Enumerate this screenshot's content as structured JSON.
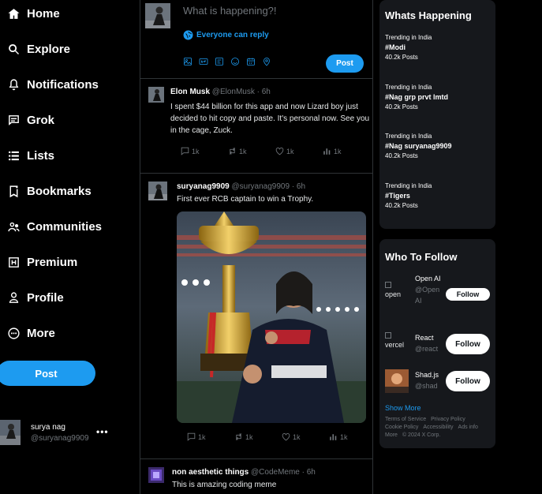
{
  "sidebar": {
    "items": [
      {
        "label": "Home",
        "icon": "home-icon"
      },
      {
        "label": "Explore",
        "icon": "search-icon"
      },
      {
        "label": "Notifications",
        "icon": "bell-icon"
      },
      {
        "label": "Grok",
        "icon": "grok-icon"
      },
      {
        "label": "Lists",
        "icon": "list-icon"
      },
      {
        "label": "Bookmarks",
        "icon": "bookmark-icon"
      },
      {
        "label": "Communities",
        "icon": "communities-icon"
      },
      {
        "label": "Premium",
        "icon": "premium-icon"
      },
      {
        "label": "Profile",
        "icon": "profile-icon"
      },
      {
        "label": "More",
        "icon": "more-circle-icon"
      }
    ],
    "post_label": "Post",
    "account": {
      "name": "surya nag",
      "handle": "@suryanag9909",
      "more": "•••"
    }
  },
  "composer": {
    "placeholder": "What is happening?!",
    "reply_setting": "Everyone can reply",
    "post_label": "Post",
    "tools": [
      "image-icon",
      "gif-icon",
      "poll-icon",
      "emoji-icon",
      "schedule-icon",
      "location-icon"
    ]
  },
  "tweets": [
    {
      "name": "Elon Musk",
      "handle": "@ElonMusk",
      "time": "· 6h",
      "text": "I spent $44 billion for this app and now Lizard boy just decided to hit copy and paste. It's personal now. See you in the cage, Zuck.",
      "stats": {
        "replies": "1k",
        "retweets": "1k",
        "likes": "1k",
        "views": "1k"
      }
    },
    {
      "name": "suryanag9909",
      "handle": "@suryanag9909",
      "time": "· 6h",
      "text": "First ever RCB captain to win a Trophy.",
      "stats": {
        "replies": "1k",
        "retweets": "1k",
        "likes": "1k",
        "views": "1k"
      }
    },
    {
      "name": "non aesthetic things",
      "handle": "@CodeMeme",
      "time": "· 6h",
      "text": "This is amazing coding meme"
    }
  ],
  "whats_happening": {
    "title": "Whats Happening",
    "trends": [
      {
        "context": "Trending in India",
        "tag": "#Modi",
        "count": "40.2k Posts"
      },
      {
        "context": "Trending in India",
        "tag": "#Nag grp prvt lmtd",
        "count": "40.2k Posts"
      },
      {
        "context": "Trending in India",
        "tag": "#Nag suryanag9909",
        "count": "40.2k Posts"
      },
      {
        "context": "Trending in India",
        "tag": "#Tigers",
        "count": "40.2k Posts"
      }
    ]
  },
  "who_to_follow": {
    "title": "Who To Follow",
    "accounts": [
      {
        "name": "Open AI",
        "handle": "@Open AI",
        "logo_alt": "open",
        "button": "Follow"
      },
      {
        "name": "React",
        "handle": "@react",
        "logo_alt": "vercel",
        "button": "Follow"
      },
      {
        "name": "Shad.js",
        "handle": "@shad",
        "logo_alt": "",
        "button": "Follow"
      }
    ],
    "show_more": "Show More",
    "footer": [
      "Terms of Service",
      "Privacy Policy",
      "Cookie Policy",
      "Accessibility",
      "Ads info",
      "More",
      "© 2024 X Corp."
    ]
  },
  "colors": {
    "accent": "#1d9bf0",
    "background": "#000000",
    "panel": "#16181c",
    "muted": "#71767b"
  }
}
